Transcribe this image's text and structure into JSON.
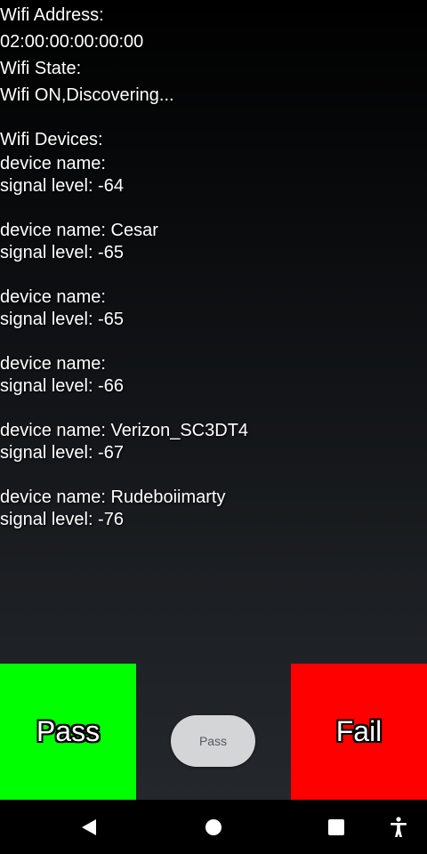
{
  "wifi": {
    "address_label": "Wifi Address:",
    "address_value": "02:00:00:00:00:00",
    "state_label": "Wifi State:",
    "state_value": "Wifi ON,Discovering...",
    "devices_label": "Wifi Devices:"
  },
  "devices": [
    {
      "name_line": "device name:",
      "signal_line": "signal level: -64"
    },
    {
      "name_line": "device name: Cesar",
      "signal_line": "signal level: -65"
    },
    {
      "name_line": "device name:",
      "signal_line": "signal level: -65"
    },
    {
      "name_line": "device name:",
      "signal_line": "signal level: -66"
    },
    {
      "name_line": "device name: Verizon_SC3DT4",
      "signal_line": "signal level: -67"
    },
    {
      "name_line": "device name: Rudeboiimarty",
      "signal_line": "signal level: -76"
    }
  ],
  "buttons": {
    "pass_big_label": "Pass",
    "pass_small_label": "Pass",
    "fail_big_label": "Fail"
  },
  "colors": {
    "pass": "#00ff00",
    "fail": "#ff0000",
    "pill": "#d4d5d7"
  },
  "navbar": {
    "icons": [
      "back-icon",
      "home-icon",
      "recents-icon",
      "accessibility-icon"
    ]
  }
}
